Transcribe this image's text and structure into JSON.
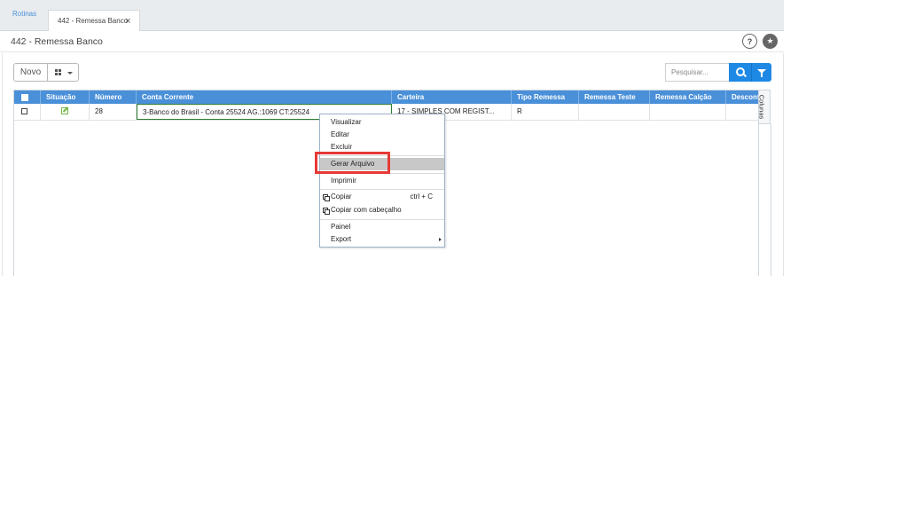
{
  "tabs": [
    {
      "label": "Rotinas"
    },
    {
      "label": "442 - Remessa Banco",
      "close": "×"
    }
  ],
  "page": {
    "title": "442 - Remessa Banco",
    "help_icon": "?",
    "fav_icon": "★"
  },
  "toolbar": {
    "new_label": "Novo",
    "grid_icon": "grid-icon",
    "search_placeholder": "Pesquisar..."
  },
  "table": {
    "columns": [
      "Situação",
      "Número",
      "Conta Corrente",
      "Carteira",
      "Tipo Remessa",
      "Remessa Teste",
      "Remessa Calção",
      "Descont"
    ],
    "rows": [
      {
        "situacao_icon": "edit-icon",
        "numero": "28",
        "conta_corrente": "3-Banco do Brasil - Conta 25524 AG.:1069 CT:25524",
        "carteira": "17 - SIMPLES COM REGIST...",
        "tipo_remessa": "R",
        "remessa_teste": "",
        "remessa_calcao": "",
        "desconto": ""
      }
    ],
    "columns_tab_label": "Colunas"
  },
  "context_menu": {
    "items": [
      {
        "label": "Visualizar"
      },
      {
        "label": "Editar"
      },
      {
        "label": "Excluir"
      },
      {
        "label": "Gerar Arquivo",
        "highlighted": true
      },
      {
        "label": "Imprimir"
      },
      {
        "label": "Copiar",
        "shortcut": "ctrl + C",
        "icon": "copy-icon"
      },
      {
        "label": "Copiar com cabeçalho",
        "icon": "copy-icon"
      },
      {
        "label": "Painel"
      },
      {
        "label": "Export",
        "submenu": true
      }
    ]
  },
  "colors": {
    "accent": "#1e88e5",
    "header_blue": "#4a90d9",
    "highlight_red": "#e53935",
    "status_green": "#6cb33f"
  }
}
